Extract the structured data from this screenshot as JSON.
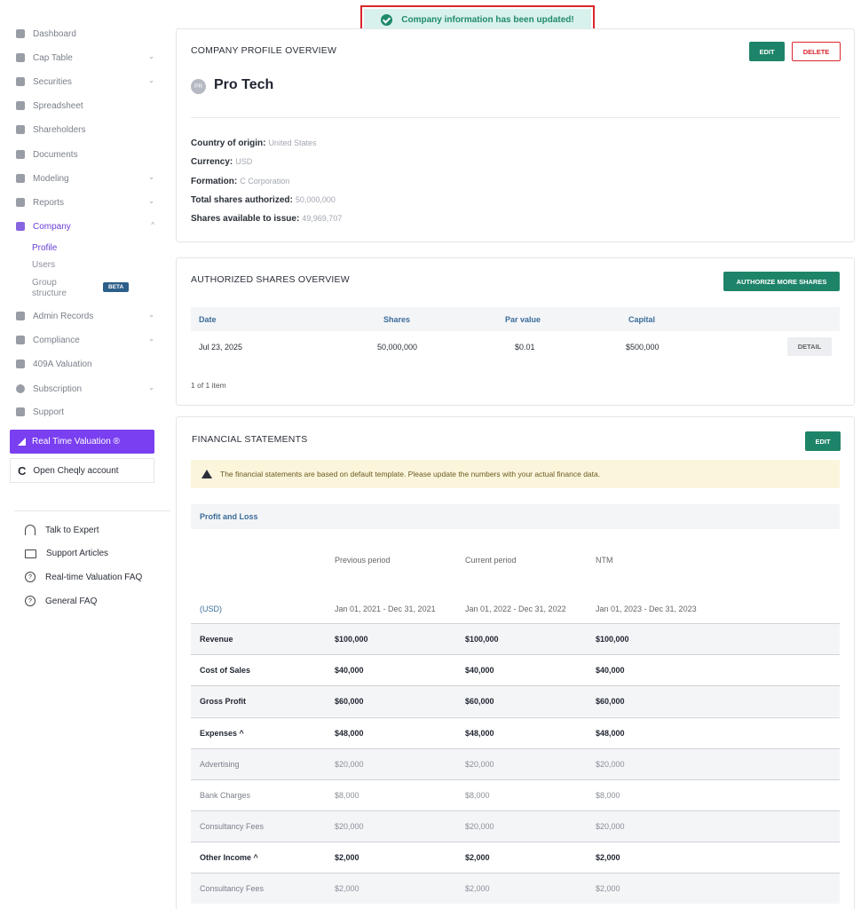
{
  "toast": {
    "message": "Company information has been updated!"
  },
  "sidebar": {
    "items": [
      {
        "label": "Dashboard",
        "chevron": ""
      },
      {
        "label": "Cap Table",
        "chevron": "⌄"
      },
      {
        "label": "Securities",
        "chevron": "⌄"
      },
      {
        "label": "Spreadsheet",
        "chevron": ""
      },
      {
        "label": "Shareholders",
        "chevron": ""
      },
      {
        "label": "Documents",
        "chevron": ""
      },
      {
        "label": "Modeling",
        "chevron": "⌄"
      },
      {
        "label": "Reports",
        "chevron": "⌄"
      },
      {
        "label": "Company",
        "chevron": "^"
      },
      {
        "label": "Admin Records",
        "chevron": "⌄"
      },
      {
        "label": "Compliance",
        "chevron": "⌄"
      },
      {
        "label": "409A Valuation",
        "chevron": ""
      },
      {
        "label": "Subscription",
        "chevron": "⌄"
      },
      {
        "label": "Support",
        "chevron": ""
      }
    ],
    "sub_items": {
      "profile": "Profile",
      "users": "Users",
      "group_line1": "Group",
      "group_line2": "structure",
      "beta": "BETA"
    },
    "real_time_valuation": "Real Time Valuation ®",
    "open_cheqly": "Open Cheqly account",
    "cheqly_logo": "C",
    "help": [
      {
        "label": "Talk to Expert",
        "icon": "headset-icon"
      },
      {
        "label": "Support Articles",
        "icon": "book-icon"
      },
      {
        "label": "Real-time Valuation FAQ",
        "icon": "question-icon"
      },
      {
        "label": "General FAQ",
        "icon": "question-icon"
      }
    ]
  },
  "profile": {
    "title": "COMPANY PROFILE OVERVIEW",
    "edit": "EDIT",
    "delete": "DELETE",
    "avatar": "PR",
    "company_name": "Pro Tech",
    "fields": [
      {
        "label": "Country of origin:",
        "value": "United States"
      },
      {
        "label": "Currency:",
        "value": "USD"
      },
      {
        "label": "Formation:",
        "value": "C Corporation"
      },
      {
        "label": "Total shares authorized:",
        "value": "50,000,000"
      },
      {
        "label": "Shares available to issue:",
        "value": "49,969,707"
      }
    ]
  },
  "authorized": {
    "title": "AUTHORIZED SHARES OVERVIEW",
    "button": "AUTHORIZE MORE SHARES",
    "headers": [
      "Date",
      "Shares",
      "Par value",
      "Capital"
    ],
    "row": {
      "date": "Jul 23, 2025",
      "shares": "50,000,000",
      "par": "$0.01",
      "capital": "$500,000",
      "detail": "DETAIL"
    },
    "pager": "1 of 1 item"
  },
  "financial": {
    "title": "FINANCIAL STATEMENTS",
    "edit": "EDIT",
    "warning": "The financial statements are based on default template. Please update the numbers with your actual finance data.",
    "section": "Profit and Loss",
    "periods": [
      "Previous period",
      "Current period",
      "NTM"
    ],
    "currency": "(USD)",
    "ranges": [
      "Jan 01, 2021 - Dec 31, 2021",
      "Jan 01, 2022 - Dec 31, 2022",
      "Jan 01, 2023 - Dec 31, 2023"
    ],
    "rows": [
      {
        "label": "Revenue",
        "v": [
          "$100,000",
          "$100,000",
          "$100,000"
        ]
      },
      {
        "label": "Cost of Sales",
        "v": [
          "$40,000",
          "$40,000",
          "$40,000"
        ]
      },
      {
        "label": "Gross Profit",
        "v": [
          "$60,000",
          "$60,000",
          "$60,000"
        ]
      },
      {
        "label": "Expenses ^",
        "v": [
          "$48,000",
          "$48,000",
          "$48,000"
        ]
      },
      {
        "label": "Advertising",
        "v": [
          "$20,000",
          "$20,000",
          "$20,000"
        ]
      },
      {
        "label": "Bank Charges",
        "v": [
          "$8,000",
          "$8,000",
          "$8,000"
        ]
      },
      {
        "label": "Consultancy Fees",
        "v": [
          "$20,000",
          "$20,000",
          "$20,000"
        ]
      },
      {
        "label": "Other Income ^",
        "v": [
          "$2,000",
          "$2,000",
          "$2,000"
        ]
      },
      {
        "label": "Consultancy Fees",
        "v": [
          "$2,000",
          "$2,000",
          "$2,000"
        ]
      }
    ]
  }
}
